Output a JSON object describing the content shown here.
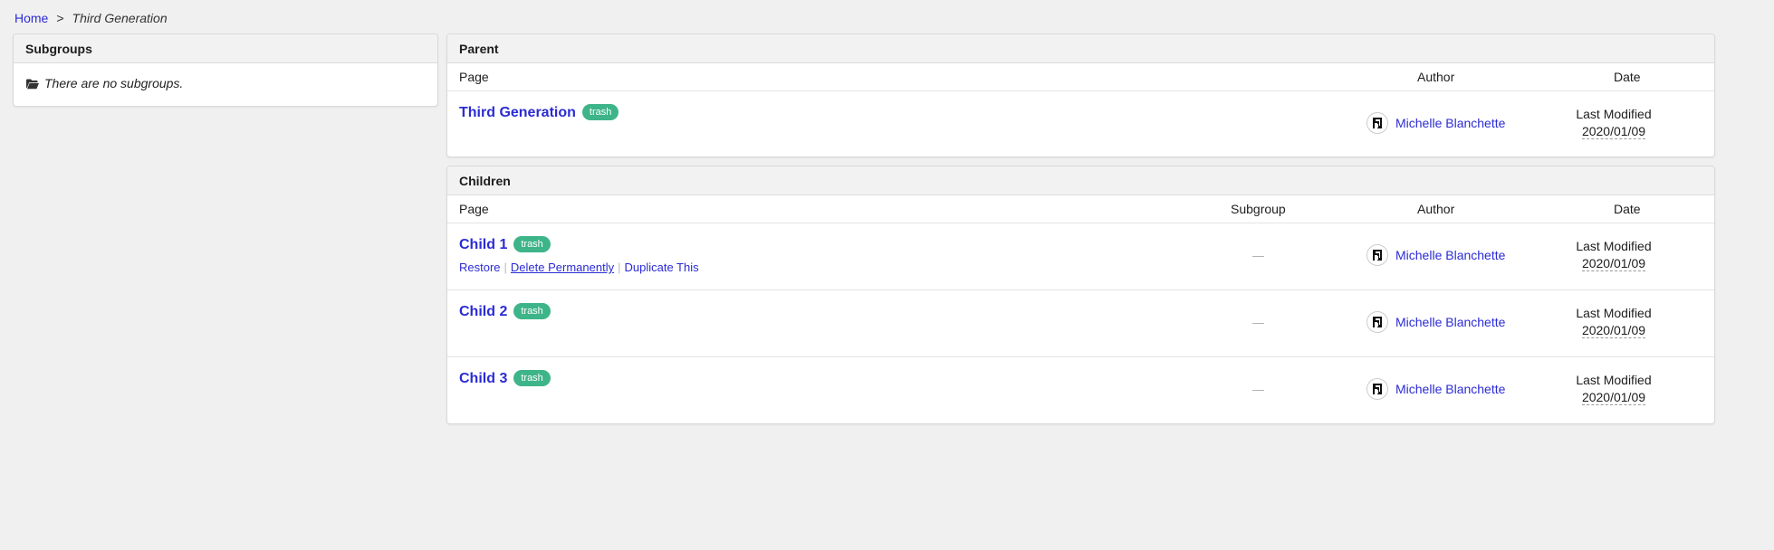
{
  "breadcrumb": {
    "home": "Home",
    "separator": ">",
    "current": "Third Generation"
  },
  "subgroups": {
    "title": "Subgroups",
    "empty_text": "There are no subgroups.",
    "icon": "folder-open-icon"
  },
  "parent": {
    "title": "Parent",
    "columns": {
      "page": "Page",
      "author": "Author",
      "date": "Date"
    },
    "row": {
      "title": "Third Generation",
      "badge": "trash",
      "author": "Michelle Blanchette",
      "date_label": "Last Modified",
      "date_value": "2020/01/09"
    }
  },
  "children": {
    "title": "Children",
    "columns": {
      "page": "Page",
      "subgroup": "Subgroup",
      "author": "Author",
      "date": "Date"
    },
    "actions": {
      "restore": "Restore",
      "delete": "Delete Permanently",
      "duplicate": "Duplicate This"
    },
    "rows": [
      {
        "title": "Child 1",
        "badge": "trash",
        "subgroup": "—",
        "author": "Michelle Blanchette",
        "date_label": "Last Modified",
        "date_value": "2020/01/09"
      },
      {
        "title": "Child 2",
        "badge": "trash",
        "subgroup": "—",
        "author": "Michelle Blanchette",
        "date_label": "Last Modified",
        "date_value": "2020/01/09"
      },
      {
        "title": "Child 3",
        "badge": "trash",
        "subgroup": "—",
        "author": "Michelle Blanchette",
        "date_label": "Last Modified",
        "date_value": "2020/01/09"
      }
    ]
  },
  "colors": {
    "link": "#2b2bd4",
    "badge": "#3eb489",
    "background": "#f0f0f0"
  }
}
